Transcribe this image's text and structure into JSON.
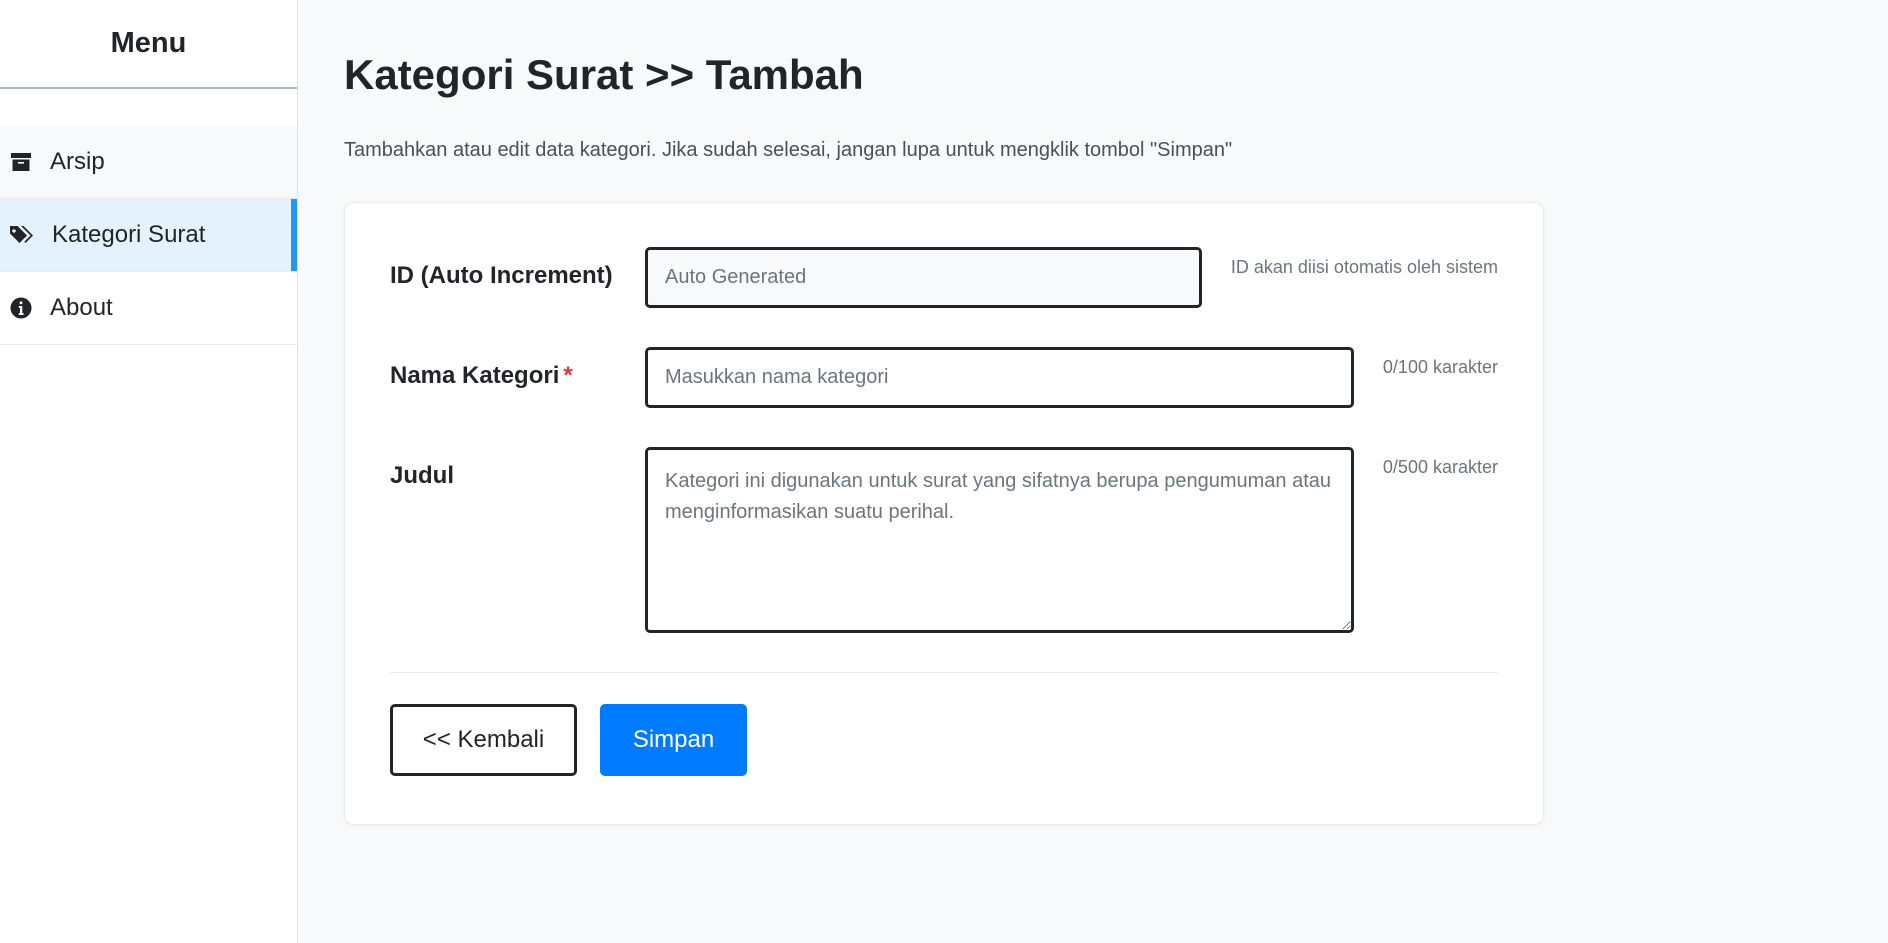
{
  "sidebar": {
    "title": "Menu",
    "items": [
      {
        "label": "Arsip",
        "icon": "archive-icon"
      },
      {
        "label": "Kategori Surat",
        "icon": "tags-icon",
        "active": true
      },
      {
        "label": "About",
        "icon": "info-circle-icon"
      }
    ]
  },
  "page": {
    "title": "Kategori Surat >> Tambah",
    "description": "Tambahkan atau edit data kategori. Jika sudah selesai, jangan lupa untuk mengklik tombol \"Simpan\""
  },
  "form": {
    "id_field": {
      "label": "ID (Auto Increment)",
      "placeholder": "Auto Generated",
      "hint": "ID akan diisi otomatis oleh sistem"
    },
    "name_field": {
      "label": "Nama Kategori",
      "required_mark": "*",
      "placeholder": "Masukkan nama kategori",
      "hint": "0/100 karakter"
    },
    "title_field": {
      "label": "Judul",
      "placeholder": "Kategori ini digunakan untuk surat yang sifatnya berupa pengumuman atau menginformasikan suatu perihal.",
      "hint": "0/500 karakter"
    }
  },
  "actions": {
    "back_label": "<< Kembali",
    "save_label": "Simpan"
  },
  "colors": {
    "accent": "#007bff",
    "active_indicator": "#2196f3",
    "active_bg": "#e3f2fd",
    "required": "#dc3545"
  }
}
